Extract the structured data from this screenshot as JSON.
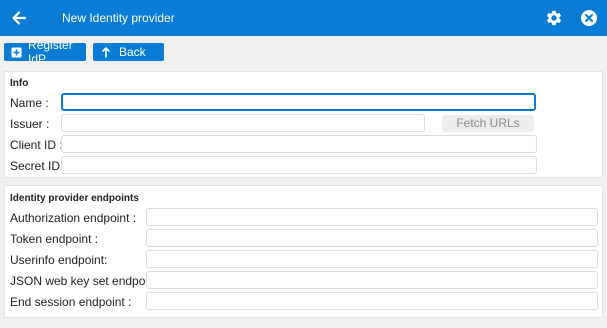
{
  "header": {
    "title": "New Identity provider",
    "back_icon": "arrow-left-icon",
    "settings_icon": "gear-icon",
    "close_icon": "close-circle-icon",
    "color": "#0a7cd6"
  },
  "toolbar": {
    "register_label": "Register IdP",
    "register_icon": "plus-box-icon",
    "back_label": "Back",
    "back_icon": "return-arrow-icon"
  },
  "info": {
    "title": "Info",
    "name_label": "Name :",
    "name_value": "",
    "issuer_label": "Issuer :",
    "issuer_value": "",
    "fetch_label": "Fetch URLs",
    "client_id_label": "Client ID :",
    "client_id_value": "",
    "secret_id_label": "Secret ID :",
    "secret_id_value": ""
  },
  "endpoints": {
    "title": "Identity provider endpoints",
    "authorization_label": "Authorization endpoint :",
    "authorization_value": "",
    "token_label": "Token endpoint :",
    "token_value": "",
    "userinfo_label": "Userinfo endpoint:",
    "userinfo_value": "",
    "jwks_label": "JSON web key set endpoint :",
    "jwks_value": "",
    "end_session_label": "End session endpoint :",
    "end_session_value": ""
  }
}
